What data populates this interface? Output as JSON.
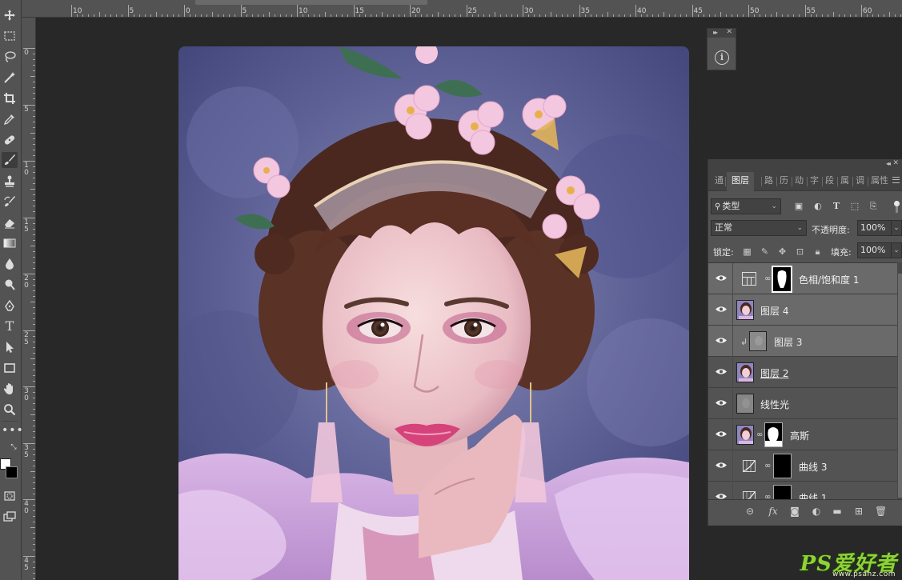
{
  "toolbar": {
    "tools": [
      "move",
      "marquee",
      "lasso",
      "magic-wand",
      "crop",
      "eyedropper",
      "healing",
      "brush",
      "clone-stamp",
      "history-brush",
      "eraser",
      "gradient",
      "blur",
      "dodge",
      "pen",
      "type",
      "path-select",
      "rectangle",
      "hand",
      "zoom",
      "more"
    ],
    "active_tool": "brush",
    "foreground_color": "#ffffff",
    "background_color": "#000000"
  },
  "rulers": {
    "top_labels": [
      "10",
      "5",
      "0",
      "5",
      "10",
      "15",
      "20",
      "25",
      "30",
      "35",
      "40",
      "45",
      "50",
      "55",
      "60"
    ],
    "left_labels": [
      "0",
      "5",
      "1\n0",
      "1\n5",
      "2\n0",
      "2\n5",
      "3\n0",
      "3\n5",
      "4\n0",
      "4\n5"
    ]
  },
  "info_panel": {
    "icon": "info-icon"
  },
  "layers_panel": {
    "tabs": [
      "通",
      "图层",
      "路",
      "历",
      "动",
      "字",
      "段",
      "属",
      "调",
      "属性"
    ],
    "active_tab": "图层",
    "filter_kind": "类型",
    "blend_mode": "正常",
    "opacity_label": "不透明度:",
    "opacity_value": "100%",
    "lock_label": "锁定:",
    "fill_label": "填充:",
    "fill_value": "100%",
    "layers": [
      {
        "name": "色相/饱和度 1",
        "type": "adjustment",
        "visible": true,
        "selected": true,
        "has_mask": true
      },
      {
        "name": "图层 4",
        "type": "image",
        "visible": true,
        "selected": true
      },
      {
        "name": "图层 3",
        "type": "gray",
        "visible": true,
        "selected": true,
        "clipped": true
      },
      {
        "name": "图层 2",
        "type": "image",
        "visible": true,
        "selected": false,
        "underlined": true
      },
      {
        "name": "线性光",
        "type": "gray",
        "visible": true,
        "selected": false
      },
      {
        "name": "高斯",
        "type": "image",
        "visible": true,
        "selected": false,
        "has_mask": true
      },
      {
        "name": "曲线 3",
        "type": "curves",
        "visible": true,
        "selected": false,
        "has_mask": true
      },
      {
        "name": "曲线 1",
        "type": "curves",
        "visible": true,
        "selected": false,
        "has_mask": true
      }
    ]
  },
  "watermark": {
    "big": "PS爱好者",
    "small": "www.psahz.com"
  }
}
